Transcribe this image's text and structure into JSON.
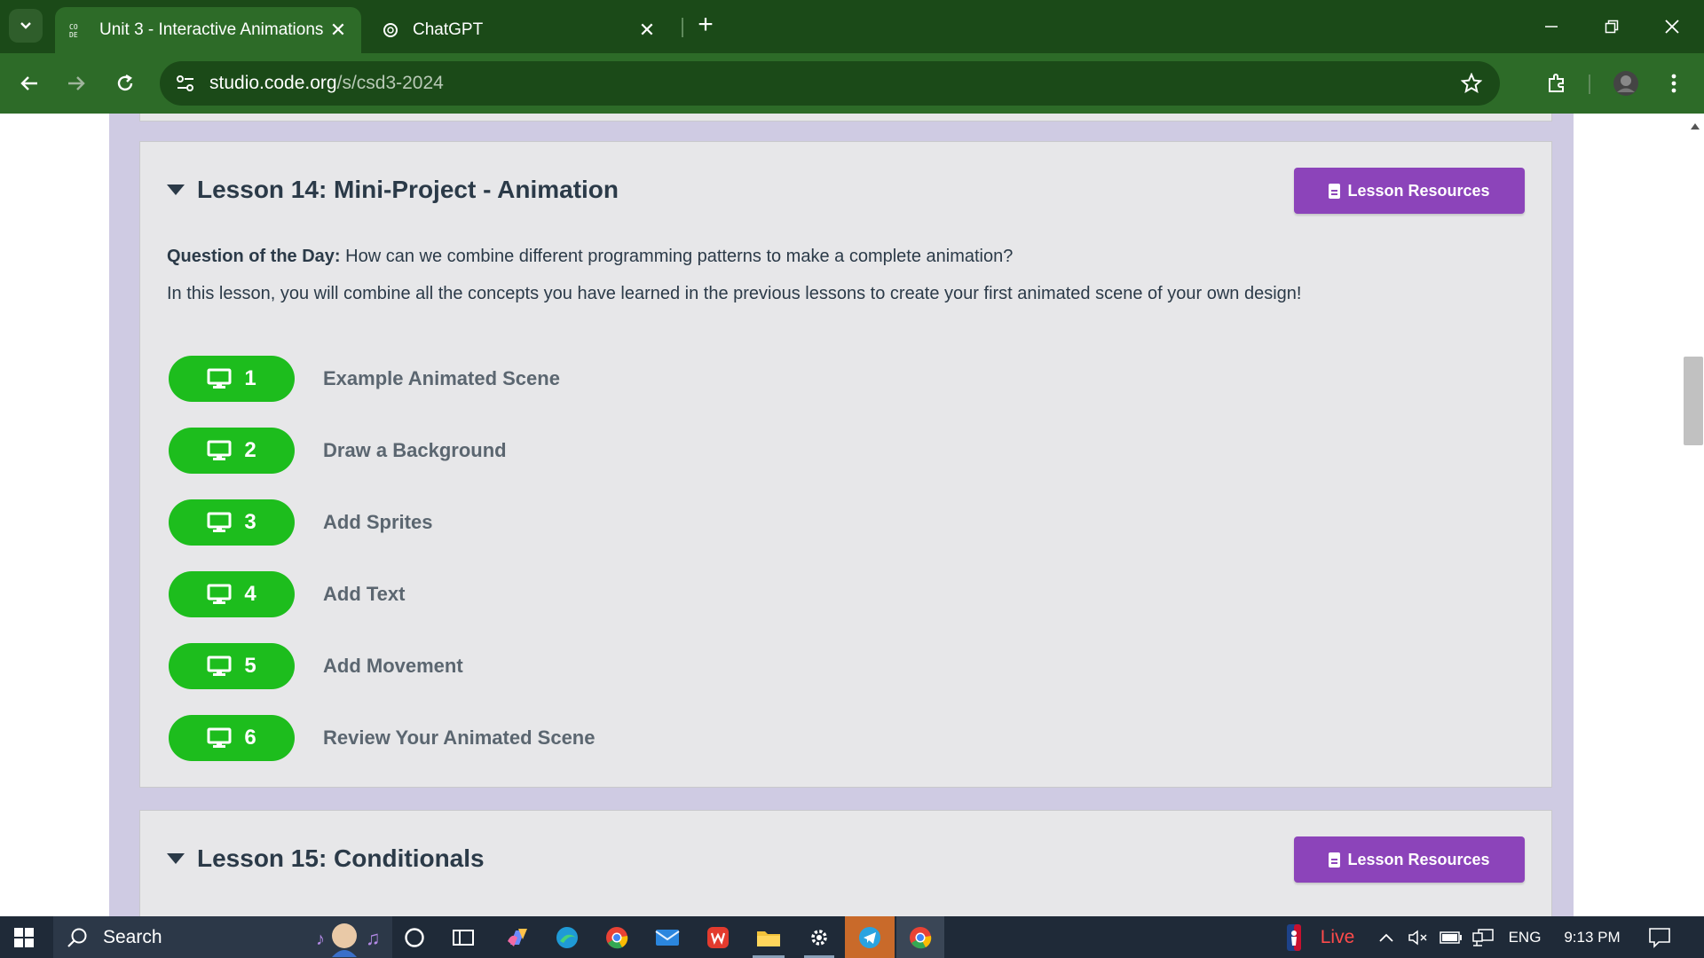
{
  "browser": {
    "tabs": [
      {
        "title": "Unit 3 - Interactive Animations",
        "close": "✕"
      },
      {
        "title": "ChatGPT",
        "close": "✕"
      }
    ],
    "new_tab": "+",
    "url": {
      "host": "studio.code.org",
      "path": "/s/csd3-2024"
    }
  },
  "lessons": [
    {
      "title": "Lesson 14: Mini-Project - Animation",
      "resources_label": "Lesson Resources",
      "qotd_label": "Question of the Day:",
      "qotd_text": " How can we combine different programming patterns to make a complete animation?",
      "description": "In this lesson, you will combine all the concepts you have learned in the previous lessons to create your first animated scene of your own design!",
      "levels": [
        {
          "number": "1",
          "name": "Example Animated Scene"
        },
        {
          "number": "2",
          "name": "Draw a Background"
        },
        {
          "number": "3",
          "name": "Add Sprites"
        },
        {
          "number": "4",
          "name": "Add Text"
        },
        {
          "number": "5",
          "name": "Add Movement"
        },
        {
          "number": "6",
          "name": "Review Your Animated Scene"
        }
      ]
    },
    {
      "title": "Lesson 15: Conditionals",
      "resources_label": "Lesson Resources"
    }
  ],
  "taskbar": {
    "search_label": "Search",
    "live_label": "Live",
    "language": "ENG",
    "time": "9:13 PM"
  },
  "colors": {
    "level_pill": "#1dbd1d",
    "resources_button": "#8c44ba",
    "browser_frame": "#2d6b28",
    "lesson_column": "#cfcbe3"
  }
}
